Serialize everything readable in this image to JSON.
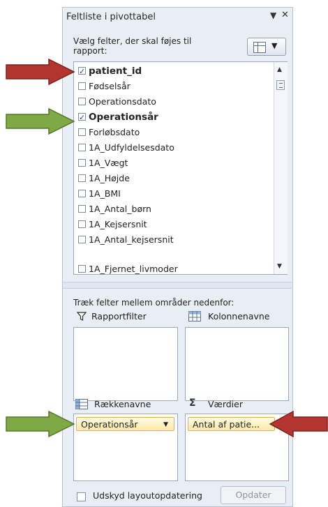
{
  "pane": {
    "title": "Feltliste i pivottabel",
    "menu_glyph": "▼",
    "close_glyph": "✕",
    "prompt": "Vælg felter, der skal føjes til rapport:",
    "layout_caret": "▼"
  },
  "fields": [
    {
      "label": "patient_id",
      "checked": true
    },
    {
      "label": "Fødselsår",
      "checked": false
    },
    {
      "label": "Operationsdato",
      "checked": false
    },
    {
      "label": "Operationsår",
      "checked": true
    },
    {
      "label": "Forløbsdato",
      "checked": false
    },
    {
      "label": "1A_Udfyldelsesdato",
      "checked": false
    },
    {
      "label": "1A_Vægt",
      "checked": false
    },
    {
      "label": "1A_Højde",
      "checked": false
    },
    {
      "label": "1A_BMI",
      "checked": false
    },
    {
      "label": "1A_Antal_børn",
      "checked": false
    },
    {
      "label": "1A_Kejsersnit",
      "checked": false
    },
    {
      "label": "1A_Antal_kejsersnit",
      "checked": false
    },
    {
      "label": "1A_Fjernet_livmoder",
      "checked": false
    }
  ],
  "areas": {
    "instruction": "Træk felter mellem områder nedenfor:",
    "report_filter": "Rapportfilter",
    "column_labels": "Kolonnenavne",
    "row_labels": "Rækkenavne",
    "values": "Værdier",
    "sigma_glyph": "Σ",
    "row_chip": "Operationsår",
    "row_chip_caret": "▼",
    "value_chip": "Antal af patie..."
  },
  "footer": {
    "defer_label": "Udskyd layoutopdatering",
    "update_label": "Opdater"
  },
  "colors": {
    "red_arrow": "#b3352f",
    "green_arrow": "#7ea945",
    "pane_bg": "#e9eef5"
  }
}
